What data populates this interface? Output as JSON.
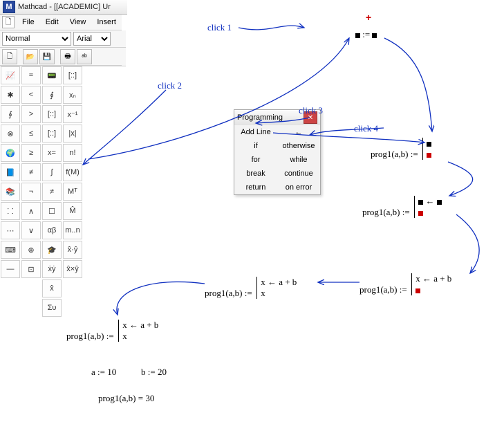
{
  "app": {
    "title": "Mathcad - [[ACADEMIC] Ur"
  },
  "menu": {
    "file": "File",
    "edit": "Edit",
    "view": "View",
    "insert": "Insert"
  },
  "format": {
    "style": "Normal",
    "font": "Arial"
  },
  "toolbar_icons": {
    "new": "🗋",
    "open": "📂",
    "save": "💾",
    "print": "🖶",
    "spell": "ᵃᵇ"
  },
  "palette_labels": {
    "col0": [
      "📈",
      "✱",
      "∮",
      "⊗",
      "🌍",
      "📘",
      "📚",
      "⸬",
      "⋯",
      "⌨",
      "—"
    ],
    "col1": [
      "=",
      "<",
      ">",
      "≤",
      "≥",
      "≠",
      "¬",
      "∧",
      "∨",
      "⊕",
      "⊡"
    ],
    "col2": [
      "📟",
      "∮",
      "[::]",
      "[::]",
      "x=",
      "∫",
      "≠",
      "☐",
      "αβ",
      "🎓",
      "ẋẏ",
      "ẋ̂",
      "Συ"
    ],
    "col3": [
      "[::]",
      "xₙ",
      "x⁻¹",
      "|x|",
      "n!",
      "f(M)",
      "Mᵀ",
      "M̂",
      "m..n",
      "x̂·ŷ",
      "x̂×ŷ"
    ]
  },
  "prog_toolbar": {
    "title": "Programming",
    "items": [
      "Add Line",
      "←",
      "if",
      "otherwise",
      "for",
      "while",
      "break",
      "continue",
      "return",
      "on error"
    ]
  },
  "annotations": {
    "c1": "click 1",
    "c2": "click 2",
    "c3": "click 3",
    "c4": "click 4"
  },
  "math": {
    "step3": "prog1(a,b)  :=",
    "step4": "prog1(a,b)  :=",
    "step5a": "prog1(a,b)  :=",
    "step5b": "x ← a + b",
    "step6a": "prog1(a,b)  :=",
    "step6b": "x ← a + b",
    "step6c": "x",
    "step7a": "prog1(a,b)  :=",
    "step7b": "x ← a + b",
    "step7c": "x",
    "def_a": "a := 10",
    "def_b": "b := 20",
    "result": "prog1(a,b) = 30"
  }
}
